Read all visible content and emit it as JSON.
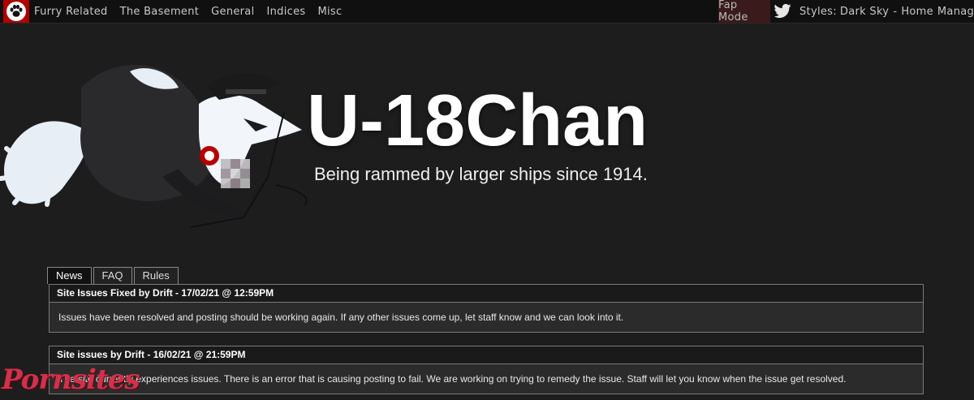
{
  "topbar": {
    "nav": [
      "Furry Related",
      "The Basement",
      "General",
      "Indices",
      "Misc"
    ],
    "fap_mode": "Fap Mode",
    "styles_label": "Styles:",
    "styles_current": "Dark Sky",
    "separator": "-",
    "home": "Home",
    "manage": "Manage"
  },
  "banner": {
    "title": "U-18Chan",
    "slogan": "Being rammed by larger ships since 1914."
  },
  "tabs": [
    "News",
    "FAQ",
    "Rules"
  ],
  "posts": [
    {
      "header": "Site Issues Fixed by Drift - 17/02/21 @ 12:59PM",
      "body": "Issues have been resolved and posting should be working again. If any other issues come up, let staff know and we can look into it."
    },
    {
      "header": "Site issues by Drift - 16/02/21 @ 21:59PM",
      "body": "The site currently experiences issues. There is an error that is causing posting to fail. We are working on trying to remedy the issue. Staff will let you know when the issue get resolved."
    }
  ],
  "watermark": "Pornsites"
}
